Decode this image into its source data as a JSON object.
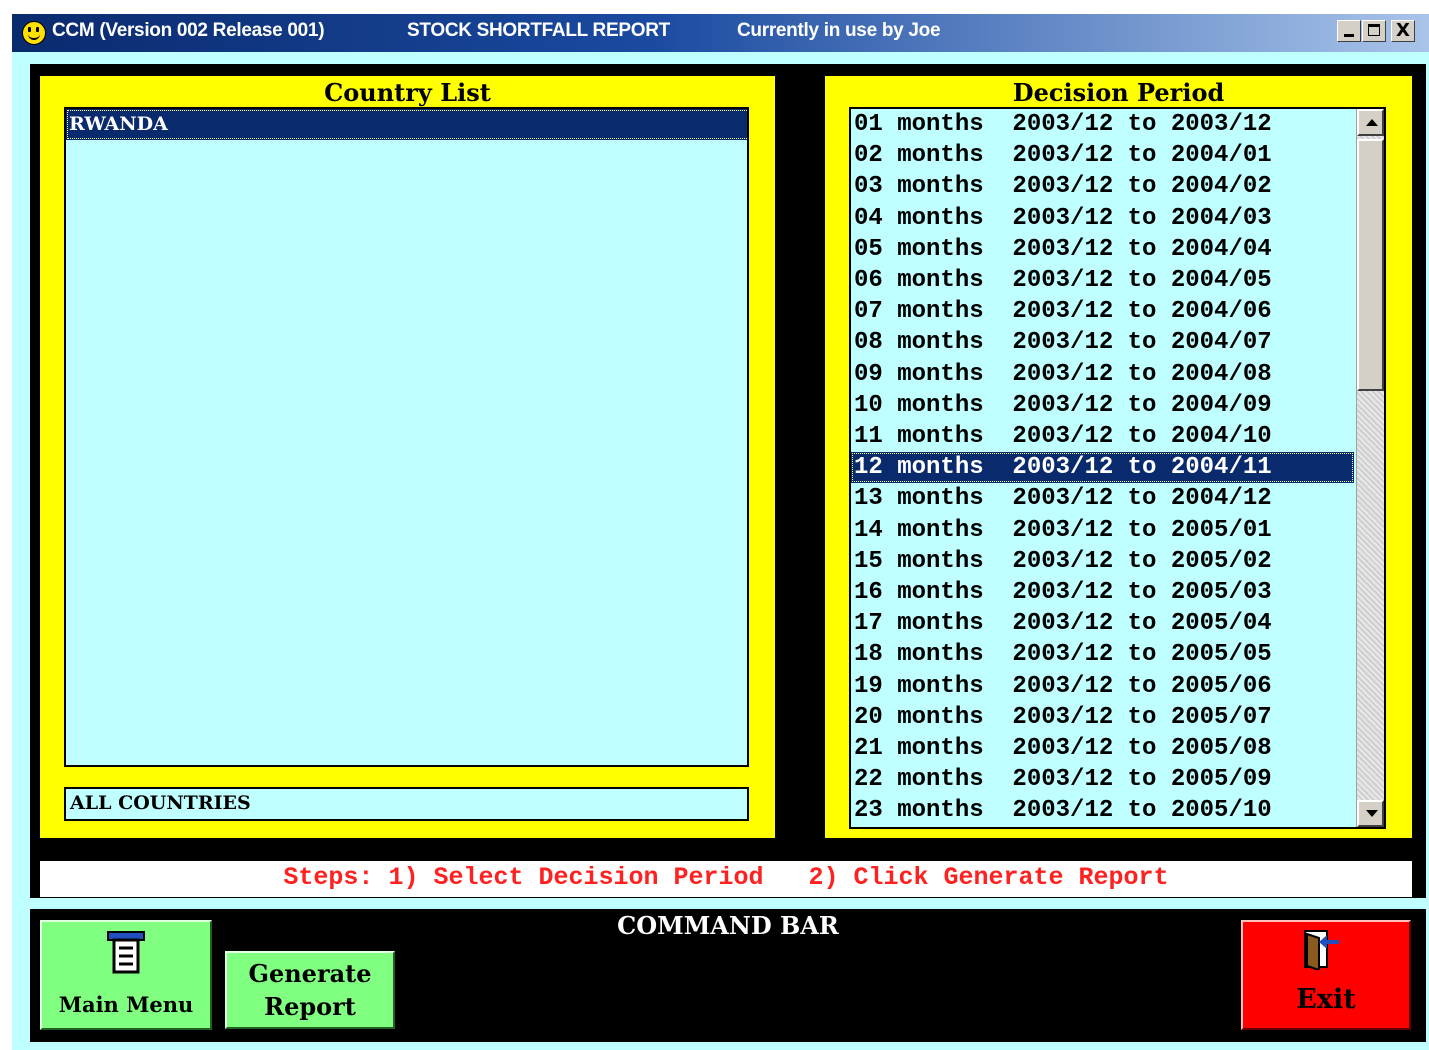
{
  "window": {
    "app_title": "CCM (Version 002  Release 001)",
    "report_title": "STOCK SHORTFALL REPORT",
    "user_status": "Currently in use by Joe",
    "min_label": "_",
    "max_label": "□",
    "close_label": "X"
  },
  "country_panel": {
    "title": "Country List",
    "items": [
      {
        "label": "RWANDA",
        "selected": true
      }
    ],
    "all_countries_label": "ALL COUNTRIES"
  },
  "decision_panel": {
    "title": "Decision Period",
    "selected_index": 11,
    "items": [
      "01 months  2003/12 to 2003/12",
      "02 months  2003/12 to 2004/01",
      "03 months  2003/12 to 2004/02",
      "04 months  2003/12 to 2004/03",
      "05 months  2003/12 to 2004/04",
      "06 months  2003/12 to 2004/05",
      "07 months  2003/12 to 2004/06",
      "08 months  2003/12 to 2004/07",
      "09 months  2003/12 to 2004/08",
      "10 months  2003/12 to 2004/09",
      "11 months  2003/12 to 2004/10",
      "12 months  2003/12 to 2004/11",
      "13 months  2003/12 to 2004/12",
      "14 months  2003/12 to 2005/01",
      "15 months  2003/12 to 2005/02",
      "16 months  2003/12 to 2005/03",
      "17 months  2003/12 to 2005/04",
      "18 months  2003/12 to 2005/05",
      "19 months  2003/12 to 2005/06",
      "20 months  2003/12 to 2005/07",
      "21 months  2003/12 to 2005/08",
      "22 months  2003/12 to 2005/09",
      "23 months  2003/12 to 2005/10"
    ]
  },
  "steps_text": "Steps: 1) Select Decision Period   2) Click Generate Report",
  "command_bar": {
    "title": "COMMAND BAR",
    "main_menu_label": "Main Menu",
    "generate_line1": "Generate",
    "generate_line2": "Report",
    "exit_label": "Exit"
  },
  "colors": {
    "panel": "#ffff00",
    "list_bg": "#bfffff",
    "selection": "#0a2a6e",
    "steps_text": "#ff2020",
    "button_green": "#80ff80",
    "exit_red": "#ff0000"
  },
  "icons": [
    "smiley-icon",
    "minimize-icon",
    "maximize-icon",
    "close-icon",
    "scroll-up-icon",
    "scroll-down-icon",
    "main-menu-icon",
    "exit-door-icon"
  ]
}
